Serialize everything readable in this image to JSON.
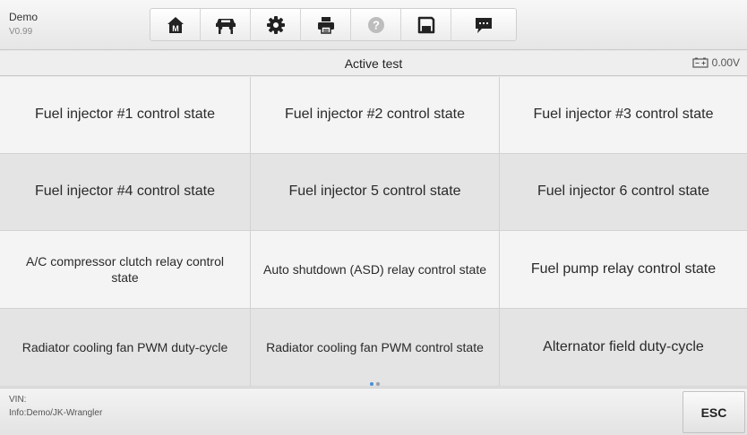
{
  "app": {
    "name": "Demo",
    "version": "V0.99"
  },
  "toolbar": [
    {
      "icon": "home-icon",
      "label": "M"
    },
    {
      "icon": "vehicle-lift-icon"
    },
    {
      "icon": "settings-gear-icon"
    },
    {
      "icon": "printer-icon"
    },
    {
      "icon": "help-icon",
      "label": "?"
    },
    {
      "icon": "save-icon"
    },
    {
      "icon": "message-icon"
    }
  ],
  "header": {
    "title": "Active test",
    "battery_voltage": "0.00V"
  },
  "tests": [
    "Fuel injector #1 control state",
    "Fuel injector #2 control state",
    "Fuel injector #3 control state",
    "Fuel injector #4 control state",
    "Fuel injector 5 control state",
    "Fuel injector 6 control state",
    "A/C compressor clutch relay control state",
    "Auto shutdown (ASD) relay control state",
    "Fuel pump relay control state",
    "Radiator cooling fan PWM duty-cycle",
    "Radiator cooling fan PWM control state",
    "Alternator field duty-cycle"
  ],
  "pager": {
    "pages": 2,
    "current": 1
  },
  "footer": {
    "vin_label": "VIN:",
    "info": "Info:Demo/JK-Wrangler",
    "esc_label": "ESC"
  },
  "colors": {
    "accent": "#4a90d9",
    "icon_dark": "#222222"
  }
}
